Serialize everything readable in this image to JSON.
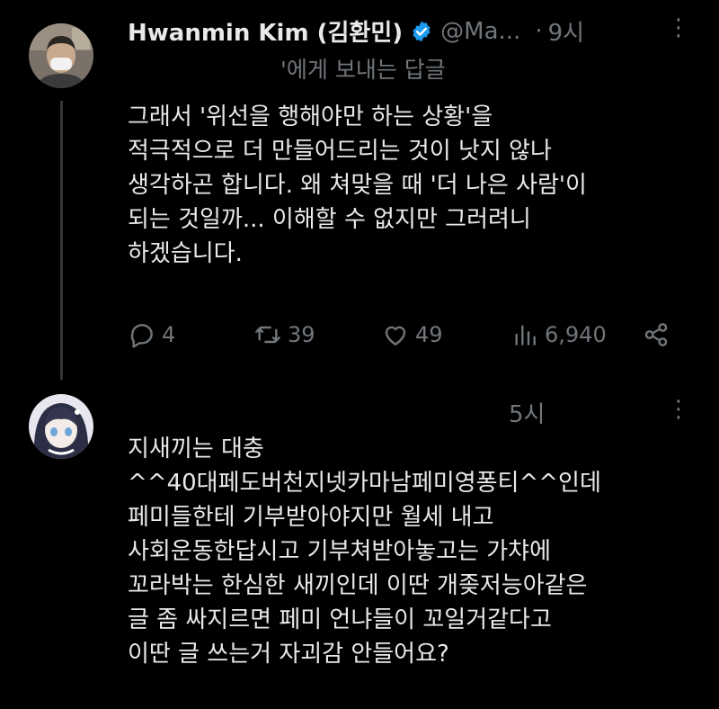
{
  "tweet1": {
    "name": "Hwanmin Kim (김환민)",
    "handle": "@Ma...",
    "time": "9시",
    "reply_to": "'에게 보내는 답글",
    "lines": [
      "그래서 '위선을 행해야만 하는 상황'을",
      "적극적으로 더 만들어드리는 것이 낫지 않나",
      "생각하곤 합니다. 왜 쳐맞을 때 '더 나은 사람'이",
      "되는 것일까... 이해할 수 없지만 그러려니",
      "하겠습니다."
    ],
    "actions": {
      "replies": "4",
      "retweets": "39",
      "likes": "49",
      "views": "6,940"
    }
  },
  "tweet2": {
    "time": "5시",
    "lines": [
      "지새끼는 대충",
      "^^40대페도버천지넷카마남페미영퐁티^^인데",
      "페미들한테 기부받아야지만 월세 내고",
      "사회운동한답시고 기부쳐받아놓고는 가챠에",
      "꼬라박는 한심한 새끼인데 이딴 개좆저능아같은",
      "글 좀 싸지르면 페미 언냐들이 꼬일거같다고",
      "이딴 글 쓰는거 자괴감 안들어요?"
    ]
  },
  "colors": {
    "background": "#000000",
    "text": "#e7e9ea",
    "muted": "#71767b",
    "verified": "#1d9bf0"
  }
}
